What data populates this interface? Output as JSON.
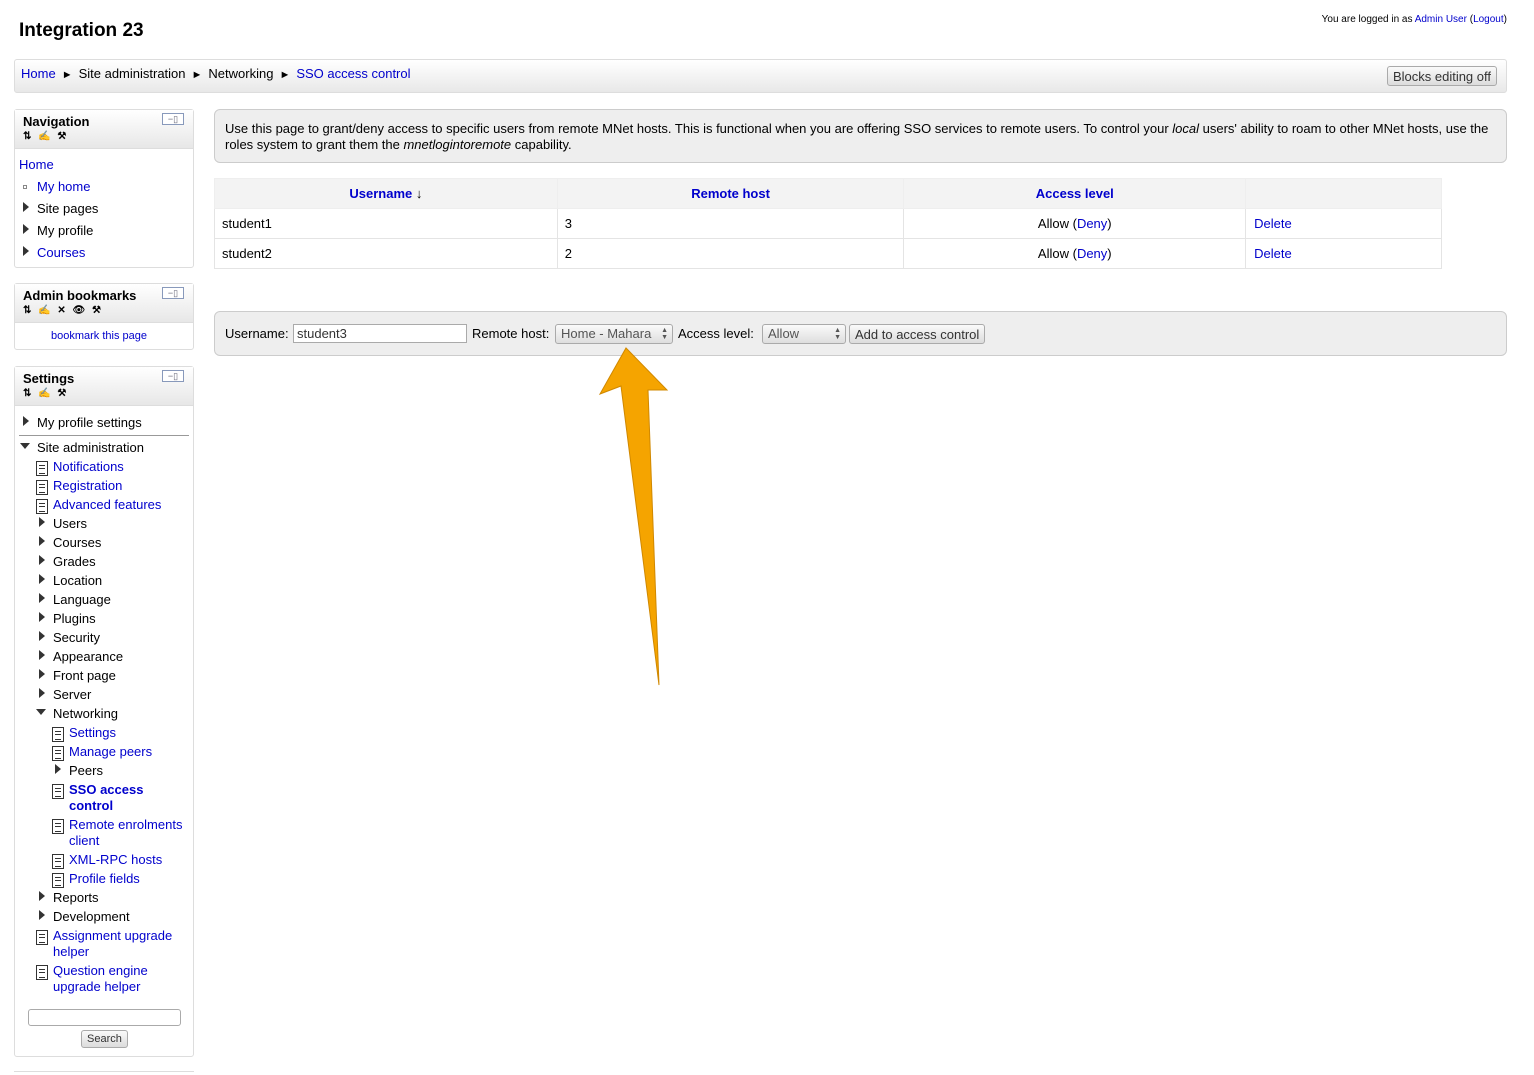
{
  "header": {
    "site_title": "Integration 23",
    "login_prefix": "You are logged in as ",
    "user_name": "Admin User",
    "logout_open": " (",
    "logout_label": "Logout",
    "logout_close": ")"
  },
  "breadcrumb": {
    "items": [
      {
        "label": "Home"
      },
      {
        "label": "Site administration"
      },
      {
        "label": "Networking"
      },
      {
        "label": "SSO access control"
      }
    ],
    "separator": "►"
  },
  "toolbar": {
    "blocks_editing_label": "Blocks editing off"
  },
  "navigation_block": {
    "title": "Navigation",
    "controls": "⇅ ✍ ⚒",
    "collapse": "−▯",
    "items": [
      {
        "label": "Home"
      },
      {
        "label": "My home"
      },
      {
        "label": "Site pages"
      },
      {
        "label": "My profile"
      },
      {
        "label": "Courses"
      }
    ]
  },
  "bookmarks_block": {
    "title": "Admin bookmarks",
    "controls": "⇅ ✍ ✕ 👁 ⚒",
    "collapse": "−▯",
    "link": "bookmark this page"
  },
  "settings_block": {
    "title": "Settings",
    "controls": "⇅ ✍ ⚒",
    "collapse": "−▯",
    "my_profile_settings": "My profile settings",
    "site_admin": "Site administration",
    "items": [
      "Notifications",
      "Registration",
      "Advanced features",
      "Users",
      "Courses",
      "Grades",
      "Location",
      "Language",
      "Plugins",
      "Security",
      "Appearance",
      "Front page",
      "Server",
      "Networking"
    ],
    "networking_items": [
      "Settings",
      "Manage peers",
      "Peers",
      "SSO access",
      "control",
      "Remote enrolments",
      "client",
      "XML-RPC hosts",
      "Profile fields"
    ],
    "tail_items": [
      "Reports",
      "Development",
      "Assignment upgrade",
      "helper",
      "Question engine",
      "upgrade helper"
    ],
    "search_value": "",
    "search_label": "Search"
  },
  "intro": {
    "part1": "Use this page to grant/deny access to specific users from remote MNet hosts. This is functional when you are offering SSO services to remote users. To control your ",
    "local": "local",
    "part2": " users' ability to roam to other MNet hosts, use the roles system to grant them the ",
    "capability_name": "mnetlogintoremote",
    "part3": " capability."
  },
  "table": {
    "headers": {
      "username": "Username",
      "sort_icon": "↓",
      "remote_host": "Remote host",
      "access_level": "Access level"
    },
    "rows": [
      {
        "username": "student1",
        "host": "3",
        "access": "Allow",
        "open": " (",
        "deny": "Deny",
        "close": ")",
        "action": "Delete"
      },
      {
        "username": "student2",
        "host": "2",
        "access": "Allow",
        "open": " (",
        "deny": "Deny",
        "close": ")",
        "action": "Delete"
      }
    ]
  },
  "form": {
    "username_label": "Username:",
    "username_value": "student3",
    "remote_host_label": "Remote host:",
    "remote_host_value": "Home - Mahara",
    "access_level_label": "Access level:",
    "access_level_value": "Allow",
    "submit_label": "Add to access control"
  },
  "annotation": {
    "arrow_color": "#f5a400"
  }
}
